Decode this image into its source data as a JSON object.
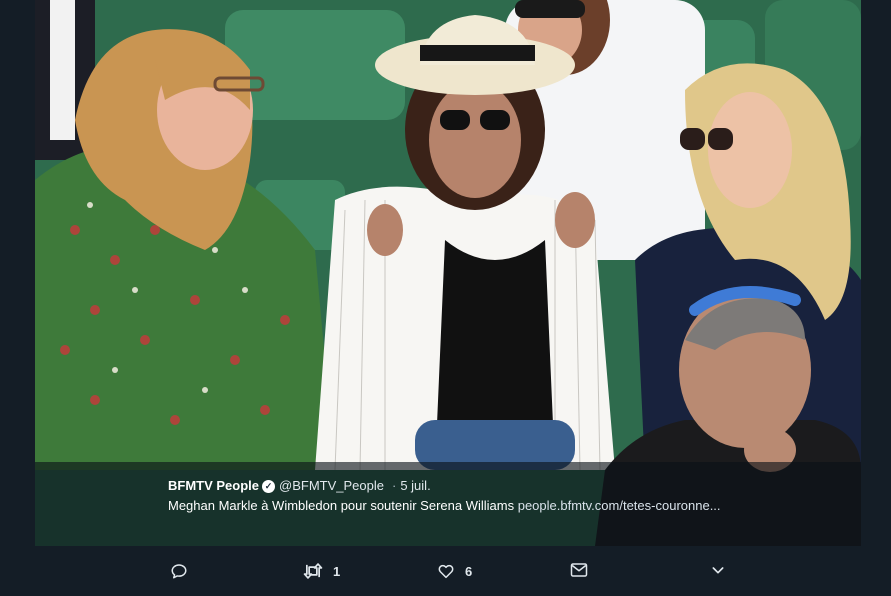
{
  "tweet": {
    "author_name": "BFMTV People",
    "verified_icon": "verified-badge-icon",
    "handle": "@BFMTV_People",
    "separator": "·",
    "date": "5 juil.",
    "text": "Meghan Markle à Wimbledon pour soutenir Serena Williams ",
    "link": "people.bfmtv.com/tetes-couronne..."
  },
  "actions": {
    "reply": {
      "icon": "reply-icon"
    },
    "retweet": {
      "icon": "retweet-icon",
      "count": "1"
    },
    "like": {
      "icon": "heart-icon",
      "count": "6"
    },
    "dm": {
      "icon": "envelope-icon"
    },
    "more": {
      "icon": "chevron-down-icon"
    }
  },
  "colors": {
    "background": "#141d26",
    "overlay": "#0a1016",
    "text": "#ffffff",
    "muted": "#aab8c2"
  }
}
